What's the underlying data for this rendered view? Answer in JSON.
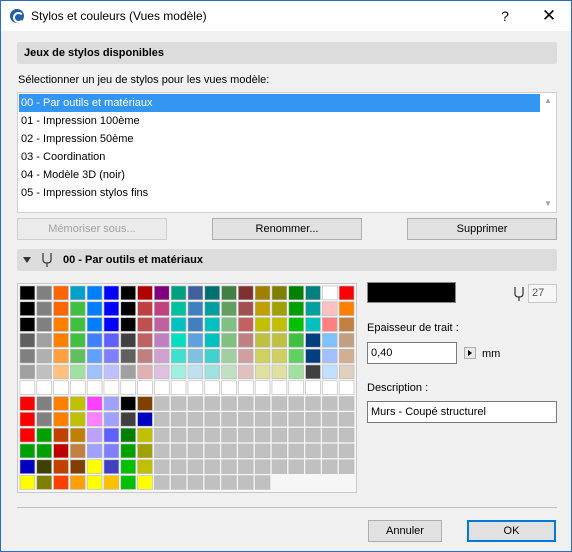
{
  "window": {
    "title": "Stylos et couleurs (Vues modèle)",
    "help_label": "?",
    "close_label": "✕"
  },
  "pensets_section": {
    "header": "Jeux de stylos disponibles",
    "select_label": "Sélectionner un jeu de stylos pour les vues modèle:",
    "items": [
      "00 - Par outils et matériaux",
      "01 - Impression 100ème",
      "02 - Impression 50ème",
      "03 - Coordination",
      "04 - Modèle 3D (noir)",
      "05 - Impression stylos fins"
    ],
    "selected_index": 0,
    "buttons": {
      "memorize": "Mémoriser sous...",
      "rename": "Renommer...",
      "delete": "Supprimer"
    }
  },
  "pen_section": {
    "header": "00 - Par outils et matériaux",
    "selected_pen_number": "27",
    "selected_pen_color": "#000000",
    "thickness_label": "Epaisseur de trait :",
    "thickness_value": "0,40",
    "thickness_unit": "mm",
    "description_label": "Description :",
    "description_value": "Murs - Coupé structurel",
    "grid_rows": [
      [
        "#000000",
        "#808080",
        "#ff6600",
        "#00a0c8",
        "#0080ff",
        "#0000ff",
        "#000000",
        "#b00000",
        "#800080",
        "#00a080",
        "#4060a0",
        "#007070",
        "#408040",
        "#803030",
        "#a08000",
        "#808000",
        "#008000",
        "#008080",
        "#ffffff",
        "#ff0000"
      ],
      [
        "#000000",
        "#808080",
        "#ff6600",
        "#40c040",
        "#0080ff",
        "#0000ff",
        "#000000",
        "#c04040",
        "#c04080",
        "#00c0a0",
        "#4080c0",
        "#00a0a0",
        "#60a060",
        "#a05050",
        "#c0a000",
        "#a0a000",
        "#00a000",
        "#00a0a0",
        "#ffc0c0",
        "#ff8000"
      ],
      [
        "#000000",
        "#808080",
        "#ff8000",
        "#40c040",
        "#0080ff",
        "#0000ff",
        "#000000",
        "#c05050",
        "#c060a0",
        "#00c0c0",
        "#4080c0",
        "#00c0c0",
        "#80c080",
        "#c06060",
        "#c0c000",
        "#c0c000",
        "#00c000",
        "#00c0c0",
        "#ff8080",
        "#c08040"
      ],
      [
        "#606060",
        "#a0a0a0",
        "#ff8000",
        "#40c040",
        "#4080ff",
        "#6060ff",
        "#404040",
        "#c06060",
        "#c080c0",
        "#00e0c0",
        "#60a0e0",
        "#00c0c0",
        "#80c080",
        "#c08080",
        "#c0c040",
        "#c0c040",
        "#40c040",
        "#004080",
        "#80c0ff",
        "#c0a080"
      ],
      [
        "#808080",
        "#b0b0b0",
        "#ffa040",
        "#60c060",
        "#60a0ff",
        "#8080ff",
        "#606060",
        "#c08080",
        "#d0a0d0",
        "#40e0d0",
        "#80c0e0",
        "#40d0d0",
        "#a0d0a0",
        "#d0a0a0",
        "#d0d060",
        "#d0d060",
        "#60d060",
        "#004080",
        "#a0c0ff",
        "#d0b090"
      ],
      [
        "#a0a0a0",
        "#c0c0c0",
        "#ffc080",
        "#a0e0a0",
        "#a0c0ff",
        "#c0c0ff",
        "#a0a0a0",
        "#e0b0b0",
        "#e0c0e0",
        "#a0f0e0",
        "#c0e0f0",
        "#a0e0e0",
        "#c0e0c0",
        "#e0c0c0",
        "#e0e0a0",
        "#e0e0a0",
        "#a0e0a0",
        "#404040",
        "#c0e0ff",
        "#e0d0c0"
      ],
      [
        "#ffffff",
        "#ffffff",
        "#ffffff",
        "#ffffff",
        "#ffffff",
        "#ffffff",
        "#ffffff",
        "#ffffff",
        "#ffffff",
        "#ffffff",
        "#ffffff",
        "#ffffff",
        "#ffffff",
        "#ffffff",
        "#ffffff",
        "#ffffff",
        "#ffffff",
        "#ffffff",
        "#ffffff",
        "#ffffff"
      ],
      [
        "#ff0000",
        "#808080",
        "#ff8000",
        "#c0c000",
        "#ff40ff",
        "#a0a0ff",
        "#000000",
        "#804000",
        "#c0c0c0",
        "#c0c0c0",
        "#c0c0c0",
        "#c0c0c0",
        "#c0c0c0",
        "#c0c0c0",
        "#c0c0c0",
        "#c0c0c0",
        "#c0c0c0",
        "#c0c0c0",
        "#c0c0c0",
        "#c0c0c0"
      ],
      [
        "#ff0000",
        "#808080",
        "#ff8000",
        "#c0c000",
        "#ff80ff",
        "#a0a0ff",
        "#404040",
        "#0000c0",
        "#c0c0c0",
        "#c0c0c0",
        "#c0c0c0",
        "#c0c0c0",
        "#c0c0c0",
        "#c0c0c0",
        "#c0c0c0",
        "#c0c0c0",
        "#c0c0c0",
        "#c0c0c0",
        "#c0c0c0",
        "#c0c0c0"
      ],
      [
        "#ff0000",
        "#00a000",
        "#c04000",
        "#c08000",
        "#c0a0ff",
        "#6060ff",
        "#008000",
        "#c0c000",
        "#c0c0c0",
        "#c0c0c0",
        "#c0c0c0",
        "#c0c0c0",
        "#c0c0c0",
        "#c0c0c0",
        "#c0c0c0",
        "#c0c0c0",
        "#c0c0c0",
        "#c0c0c0",
        "#c0c0c0",
        "#c0c0c0"
      ],
      [
        "#00a000",
        "#00a000",
        "#c00000",
        "#c08040",
        "#a0a0ff",
        "#8080ff",
        "#00a000",
        "#a0a000",
        "#c0c0c0",
        "#c0c0c0",
        "#c0c0c0",
        "#c0c0c0",
        "#c0c0c0",
        "#c0c0c0",
        "#c0c0c0",
        "#c0c0c0",
        "#c0c0c0",
        "#c0c0c0",
        "#c0c0c0",
        "#c0c0c0"
      ],
      [
        "#0000c0",
        "#404000",
        "#c04000",
        "#804000",
        "#ffff00",
        "#4040c0",
        "#00c000",
        "#c0c000",
        "#c0c0c0",
        "#c0c0c0",
        "#c0c0c0",
        "#c0c0c0",
        "#c0c0c0",
        "#c0c0c0",
        "#c0c0c0",
        "#c0c0c0",
        "#c0c0c0",
        "#c0c0c0",
        "#c0c0c0",
        "#c0c0c0"
      ],
      [
        "#ffff00",
        "#808000",
        "#ff4000",
        "#ffa000",
        "#ffff00",
        "#ffc000",
        "#00c000",
        "#ffff00",
        "#c0c0c0",
        "#c0c0c0",
        "#c0c0c0",
        "#c0c0c0",
        "#c0c0c0",
        "#c0c0c0",
        "#c0c0c0",
        "#f6f6f6",
        "#f6f6f6",
        "#f6f6f6",
        "#f6f6f6",
        "#f6f6f6"
      ]
    ],
    "selected_cell": {
      "row": 1,
      "col": 6
    }
  },
  "footer": {
    "cancel": "Annuler",
    "ok": "OK"
  },
  "colors": {
    "accent": "#3396f2",
    "border_accent": "#0078d7"
  }
}
